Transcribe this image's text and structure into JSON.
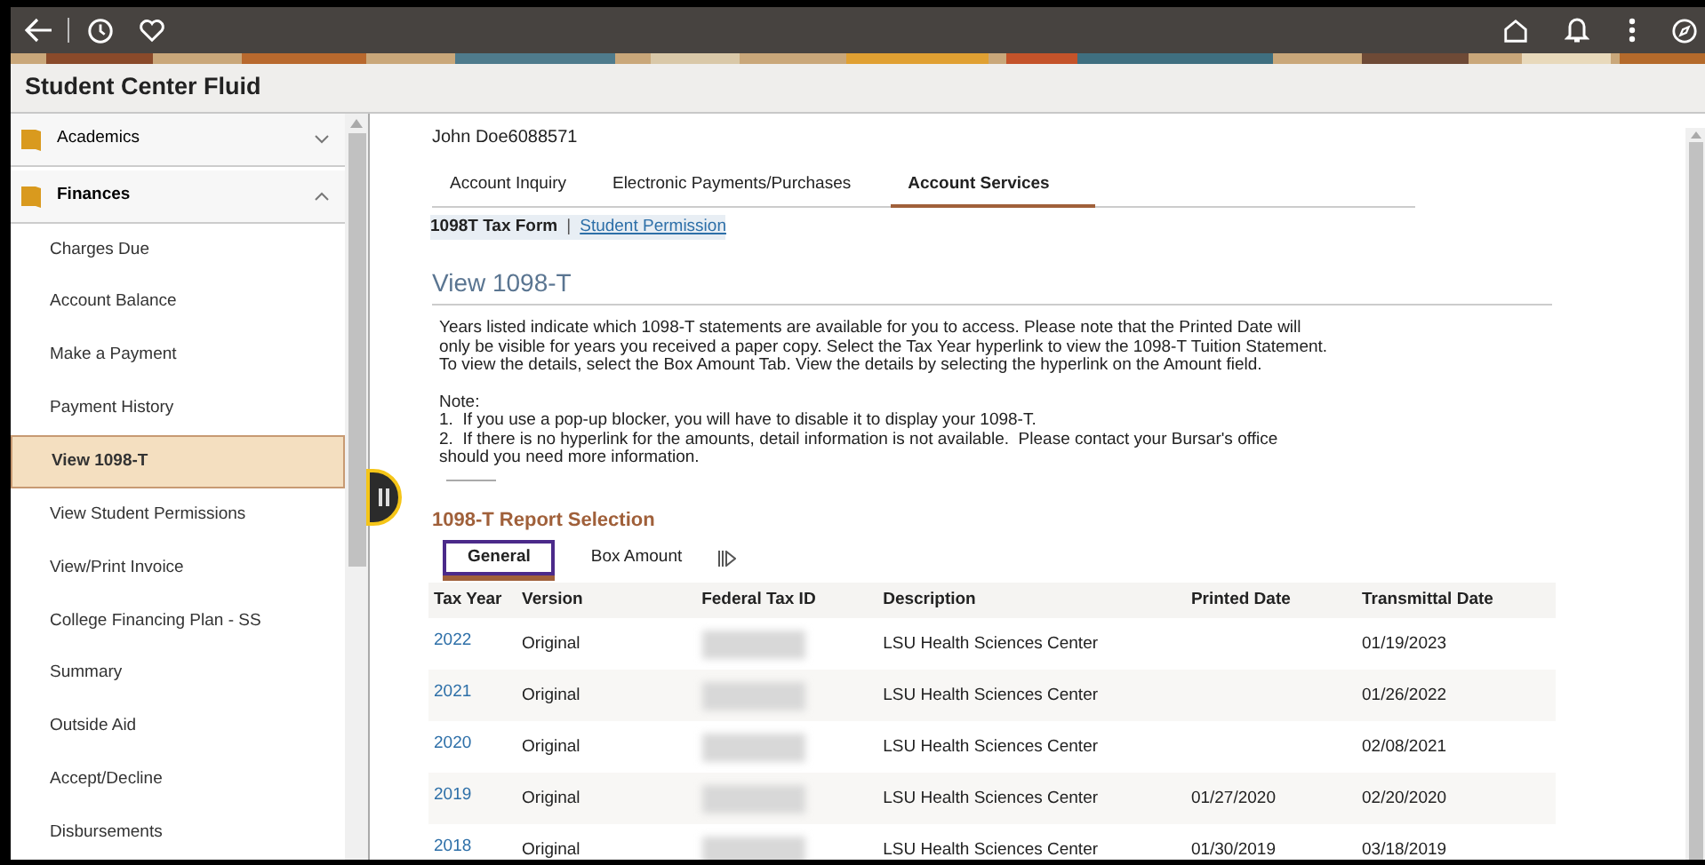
{
  "page_title": "Student Center Fluid",
  "sidebar": {
    "groups": [
      {
        "label": "Academics",
        "expanded": false
      },
      {
        "label": "Finances",
        "expanded": true
      }
    ],
    "items": [
      {
        "label": "Charges Due",
        "selected": false
      },
      {
        "label": "Account Balance",
        "selected": false
      },
      {
        "label": "Make a Payment",
        "selected": false
      },
      {
        "label": "Payment History",
        "selected": false
      },
      {
        "label": "View 1098-T",
        "selected": true
      },
      {
        "label": "View Student Permissions",
        "selected": false
      },
      {
        "label": "View/Print Invoice",
        "selected": false
      },
      {
        "label": "College Financing Plan - SS",
        "selected": false
      },
      {
        "label": "Summary",
        "selected": false
      },
      {
        "label": "Outside Aid",
        "selected": false
      },
      {
        "label": "Accept/Decline",
        "selected": false
      },
      {
        "label": "Disbursements",
        "selected": false
      }
    ]
  },
  "student_name": "John Doe6088571",
  "tabs": [
    {
      "label": "Account Inquiry",
      "selected": false
    },
    {
      "label": "Electronic Payments/Purchases",
      "selected": false
    },
    {
      "label": "Account Services",
      "selected": true
    }
  ],
  "sub_links": [
    {
      "label": "1098T Tax Form",
      "selected": true
    },
    {
      "label": "Student Permission",
      "selected": false
    }
  ],
  "sub_link_separator": "|",
  "heading": "View 1098-T",
  "intro": "Years listed indicate which 1098-T statements are available for you to access.  Please note that the Printed Date will only be visible for years you received a paper copy.  Select the Tax Year hyperlink to view the 1098-T Tuition Statement.  To view the details, select the Box Amount Tab.  View the details by selecting the hyperlink on the Amount field.",
  "note_title": "Note:",
  "notes": [
    "1.  If you use a pop-up blocker, you will have to disable it to display your 1098-T.",
    "2.  If there is no hyperlink for the amounts, detail information is not available.  Please contact your Bursar's office should you need more information."
  ],
  "report_title": "1098-T Report Selection",
  "report_tabs": [
    {
      "label": "General",
      "selected": true
    },
    {
      "label": "Box Amount",
      "selected": false
    }
  ],
  "table": {
    "columns": [
      "Tax Year",
      "Version",
      "Federal Tax ID",
      "Description",
      "Printed Date",
      "Transmittal Date"
    ],
    "rows": [
      {
        "tax_year": "2022",
        "version": "Original",
        "description": "LSU Health Sciences Center",
        "transmittal_date": "01/19/2023"
      },
      {
        "tax_year": "2021",
        "version": "Original",
        "description": "LSU Health Sciences Center",
        "transmittal_date": "01/26/2022"
      },
      {
        "tax_year": "2020",
        "version": "Original",
        "description": "LSU Health Sciences Center",
        "transmittal_date": "02/08/2021"
      },
      {
        "tax_year": "2019",
        "version": "Original",
        "description": "LSU Health Sciences Center",
        "printed_date": "01/27/2020",
        "transmittal_date": "02/20/2020"
      },
      {
        "tax_year": "2018",
        "version": "Original",
        "description": "LSU Health Sciences Center",
        "printed_date": "01/30/2019",
        "transmittal_date": "03/18/2019"
      }
    ]
  }
}
